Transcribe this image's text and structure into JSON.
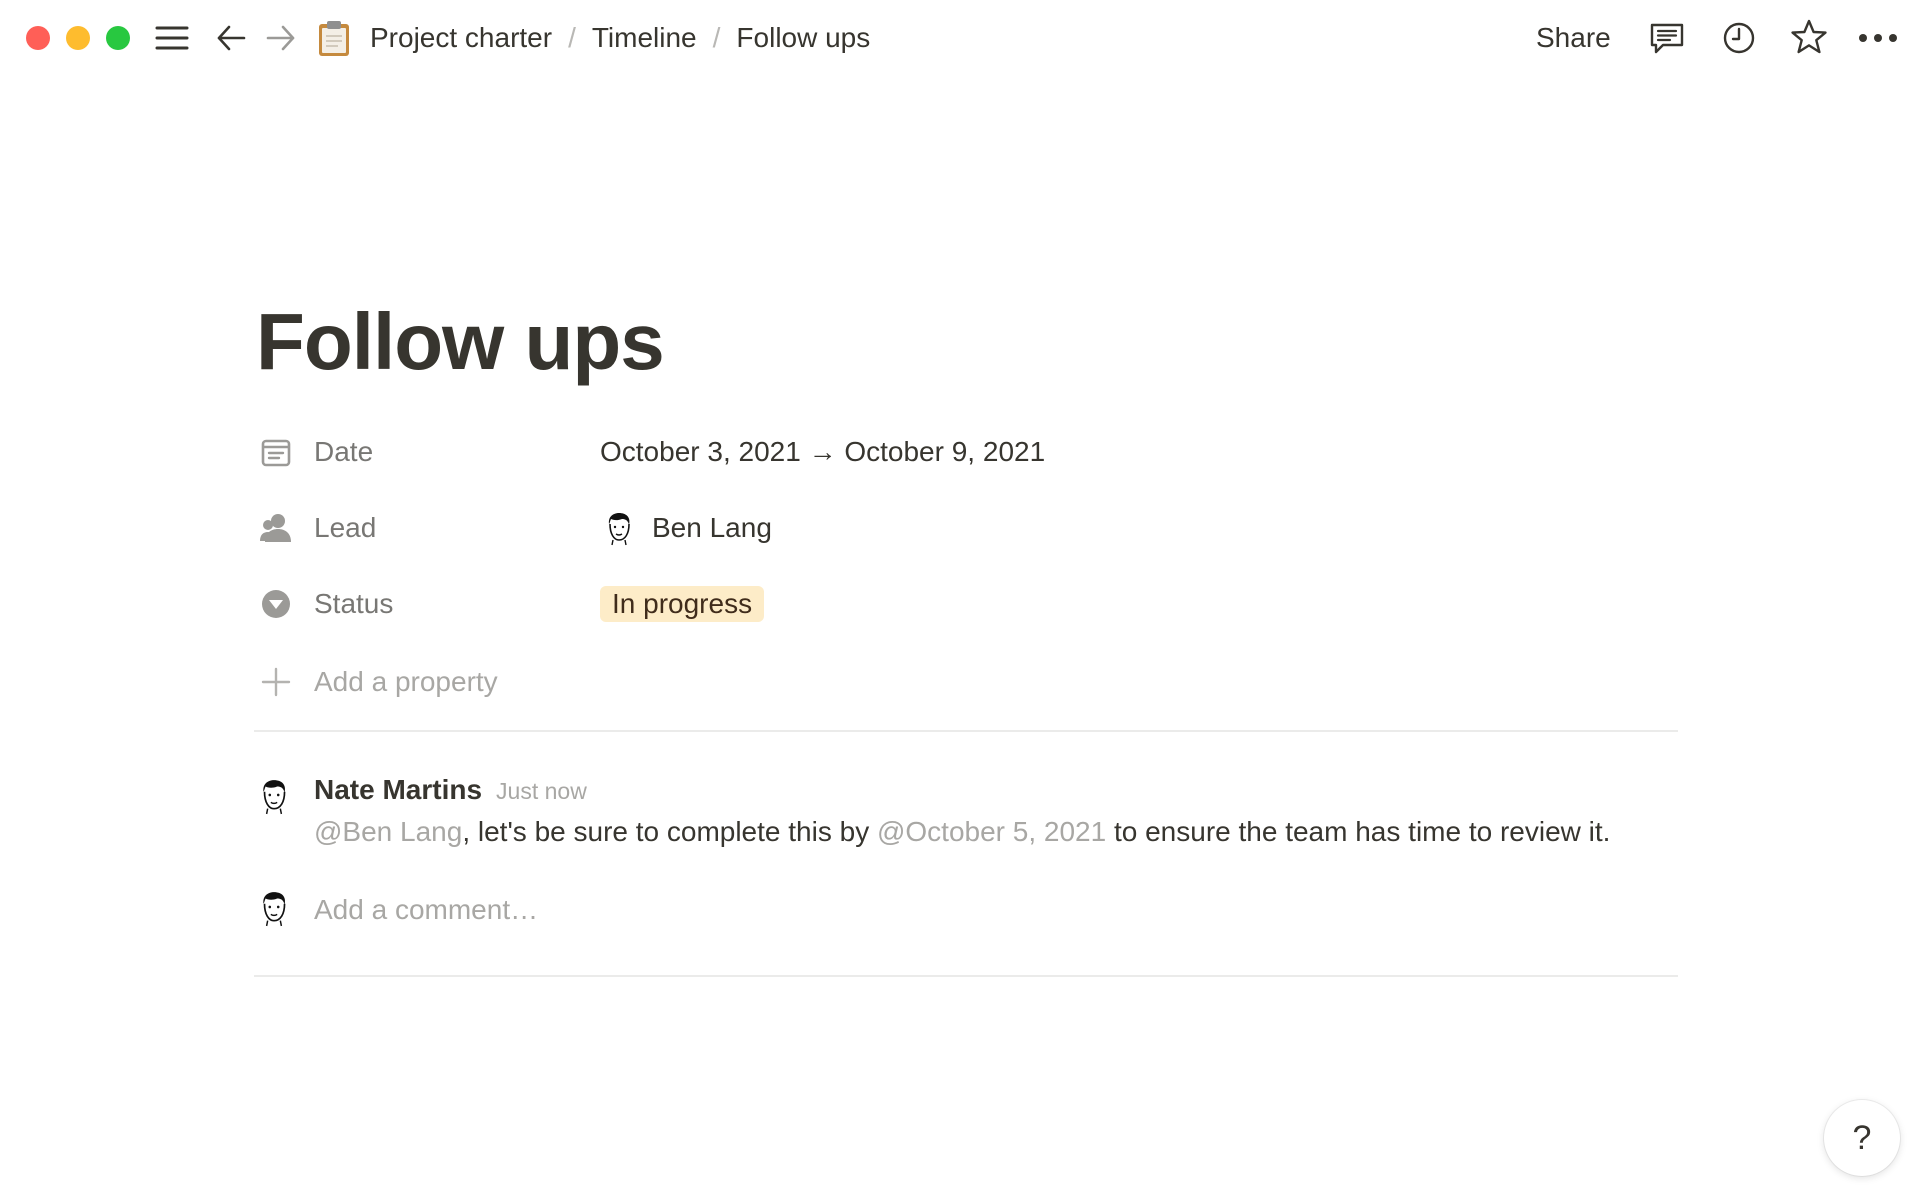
{
  "window": {
    "controls": [
      "close",
      "minimize",
      "maximize"
    ]
  },
  "topbar": {
    "icons": {
      "menu": "hamburger-menu-icon",
      "back": "arrow-left-icon",
      "forward": "arrow-right-icon",
      "comments": "comment-icon",
      "updates": "clock-icon",
      "favorite": "star-icon",
      "more": "ellipsis-icon"
    },
    "breadcrumb": [
      {
        "label": "Project charter",
        "icon": "clipboard-icon"
      },
      {
        "label": "Timeline"
      },
      {
        "label": "Follow ups"
      }
    ],
    "separator": "/",
    "share_label": "Share"
  },
  "page": {
    "title": "Follow ups",
    "properties": [
      {
        "label": "Date",
        "icon": "calendar-icon",
        "value": "October 3, 2021 → October 9, 2021"
      },
      {
        "label": "Lead",
        "icon": "person-icon",
        "value": "Ben Lang"
      },
      {
        "label": "Status",
        "icon": "select-icon",
        "value": "In progress"
      }
    ],
    "add_property_label": "Add a property"
  },
  "comments": {
    "thread": [
      {
        "author": "Nate Martins",
        "time": "Just now",
        "mention_user": "@Ben Lang",
        "text_1": ", let's be sure to complete this by ",
        "mention_date": "@October 5, 2021",
        "text_2": " to ensure the team has time to review it."
      }
    ],
    "input_placeholder": "Add a comment…"
  },
  "help": {
    "label": "?"
  },
  "colors": {
    "text": "#37352f",
    "muted": "#787774",
    "placeholder": "#a8a7a4",
    "status_bg": "#fdecc8",
    "status_text": "#402c1b",
    "divider": "#ebebea",
    "traffic_red": "#ff5f57",
    "traffic_yellow": "#febc2e",
    "traffic_green": "#28c840"
  }
}
